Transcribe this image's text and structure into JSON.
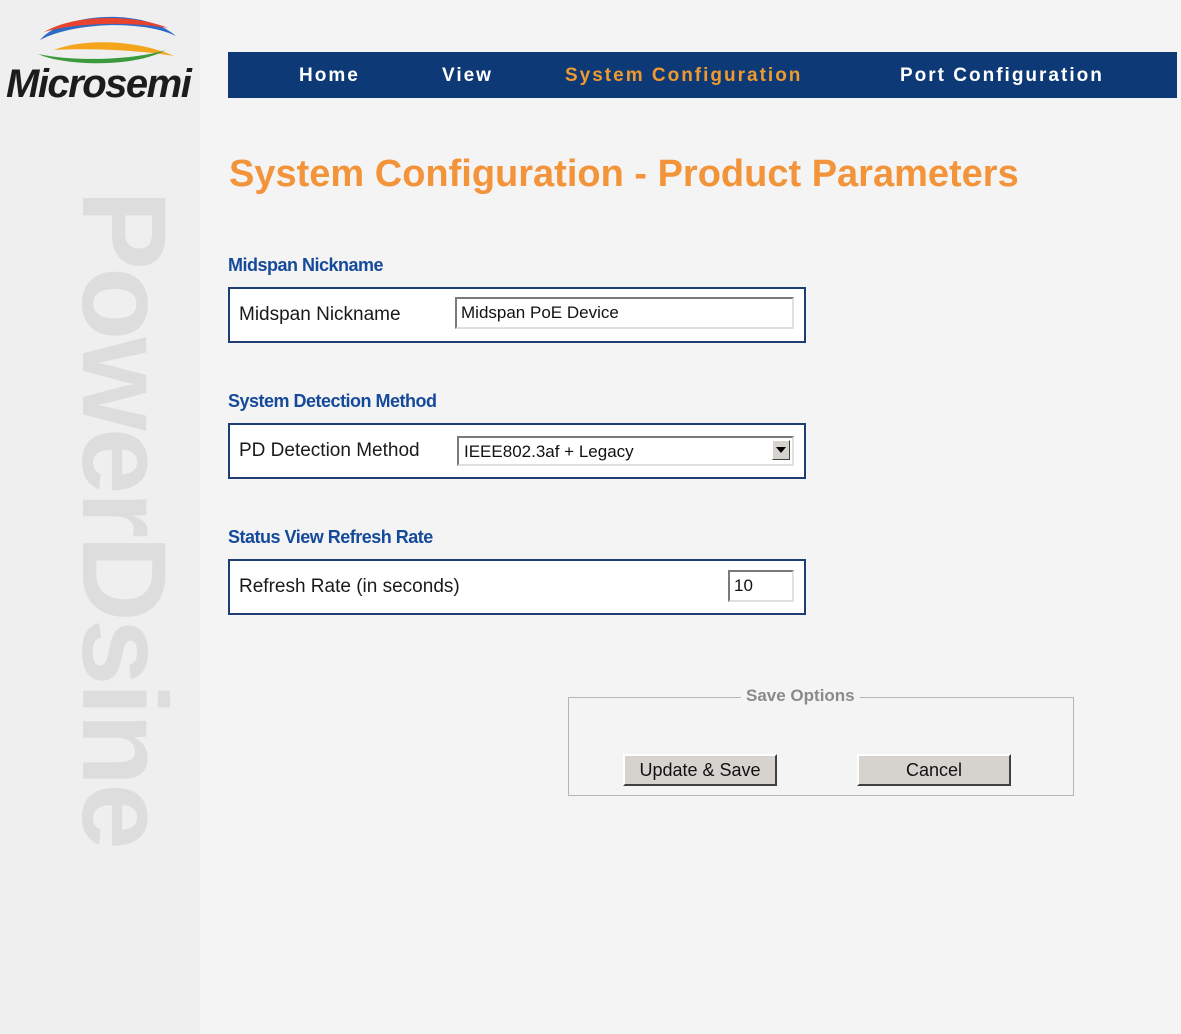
{
  "brand": {
    "logo_text": "Microsemi",
    "watermark": "PowerDsine",
    "colors": {
      "nav_bg": "#0d3a76",
      "accent": "#f3933a",
      "section": "#154a9a"
    }
  },
  "nav": {
    "items": [
      {
        "label": "Home",
        "active": false
      },
      {
        "label": "View",
        "active": false
      },
      {
        "label": "System Configuration",
        "active": true
      },
      {
        "label": "Port Configuration",
        "active": false
      }
    ]
  },
  "page": {
    "title": "System Configuration - Product Parameters"
  },
  "sections": {
    "nickname": {
      "title": "Midspan Nickname",
      "label": "Midspan Nickname",
      "value": "Midspan PoE Device"
    },
    "detection": {
      "title": "System Detection Method",
      "label": "PD Detection Method",
      "selected": "IEEE802.3af + Legacy"
    },
    "refresh": {
      "title": "Status View Refresh Rate",
      "label": "Refresh Rate (in seconds)",
      "value": "10"
    }
  },
  "save_options": {
    "legend": "Save Options",
    "update_label": "Update & Save",
    "cancel_label": "Cancel"
  }
}
